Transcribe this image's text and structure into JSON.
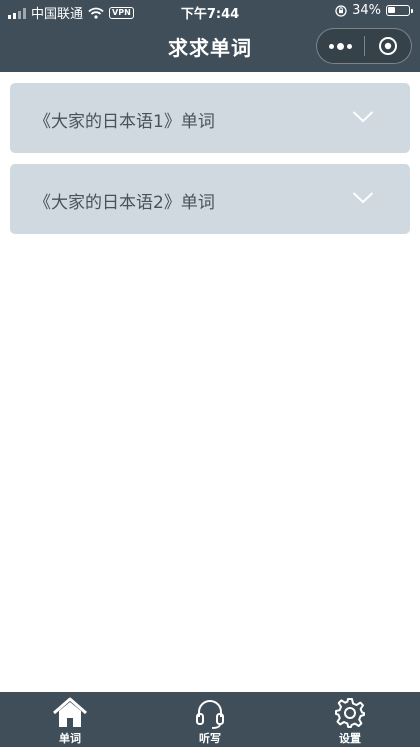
{
  "status_bar": {
    "carrier": "中国联通",
    "vpn": "VPN",
    "time": "下午7:44",
    "battery": "34%"
  },
  "nav": {
    "title": "求求单词"
  },
  "items": [
    {
      "label": "《大家的日本语1》单词"
    },
    {
      "label": "《大家的日本语2》单词"
    }
  ],
  "tabs": [
    {
      "label": "单词",
      "icon": "home-icon"
    },
    {
      "label": "听写",
      "icon": "headphones-icon"
    },
    {
      "label": "设置",
      "icon": "gear-icon"
    }
  ],
  "colors": {
    "bar": "#3f4e58",
    "card": "#cfd9df",
    "card_text": "#4a5259"
  }
}
